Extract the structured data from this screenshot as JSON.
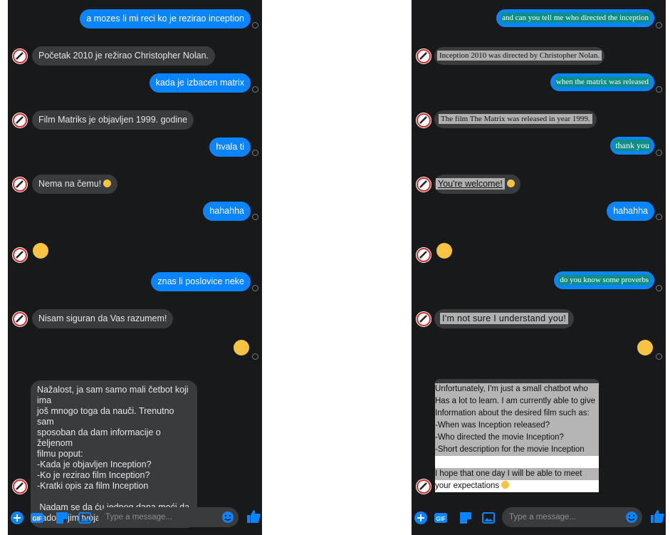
{
  "left": {
    "messages": [
      {
        "dir": "out",
        "text": "a mozes li mi reci ko je rezirao inception"
      },
      {
        "dir": "in",
        "text": "Početak 2010 je režirao Christopher Nolan."
      },
      {
        "dir": "out",
        "text": "kada je izbacen matrix"
      },
      {
        "dir": "in",
        "text": "Film Matriks je objavljen 1999. godine"
      },
      {
        "dir": "out",
        "text": "hvala ti"
      },
      {
        "dir": "in",
        "text": "Nema na čemu!"
      },
      {
        "dir": "out",
        "text": "hahahha"
      },
      {
        "dir": "out",
        "text": "znas li poslovice neke"
      },
      {
        "dir": "in",
        "text": "Nisam siguran da Vas razumem!"
      }
    ],
    "long_message": {
      "lines": [
        "Nažalost, ja sam samo mali četbot koji ima",
        "još mnogo toga da nauči. Trenutno sam",
        "sposoban da dam informacije o željenom",
        "filmu poput:",
        "-Kada je objavljen Inception?",
        "-Ko je rezirao film Inception?",
        "-Kratki opis za film Inception",
        "",
        " Nadam se da ću jednog dana moći da",
        "zadovoljim tvoja očekivanja"
      ]
    }
  },
  "right": {
    "messages": [
      {
        "dir": "out",
        "text": "and can you tell me who directed the inception"
      },
      {
        "dir": "in",
        "text": "Inception 2010 was directed by Christopher Nolan."
      },
      {
        "dir": "out",
        "text": "when the matrix was released"
      },
      {
        "dir": "in",
        "text": "The film The Matrix was released in year 1999."
      },
      {
        "dir": "out",
        "text": "thank you"
      },
      {
        "dir": "in",
        "text": "You're welcome!"
      },
      {
        "dir": "out",
        "text": "hahahha"
      },
      {
        "dir": "out",
        "text": "do you know some proverbs"
      },
      {
        "dir": "in",
        "text": "I'm not sure I understand you!"
      }
    ],
    "long_message": {
      "lines": [
        "Unfortunately, I'm just a small chatbot who",
        "Has a lot to learn. I am currently able to give",
        "Information about the desired film such as:",
        "-When was Inception released?",
        "-Who directed the movie Inception?",
        "-Short description for the movie Inception",
        "",
        "I hope that one day I will be able to meet",
        "your expectations"
      ]
    }
  },
  "composer": {
    "placeholder": "Type a message...",
    "icons": [
      "plus-icon",
      "gif-icon",
      "sticker-icon",
      "image-icon",
      "emoji-icon",
      "thumbs-up-icon"
    ]
  },
  "colors": {
    "accent": "#0a84ff",
    "background": "#18191b",
    "incoming": "#3a3b3d",
    "translated_highlight": "#0e8f86"
  }
}
